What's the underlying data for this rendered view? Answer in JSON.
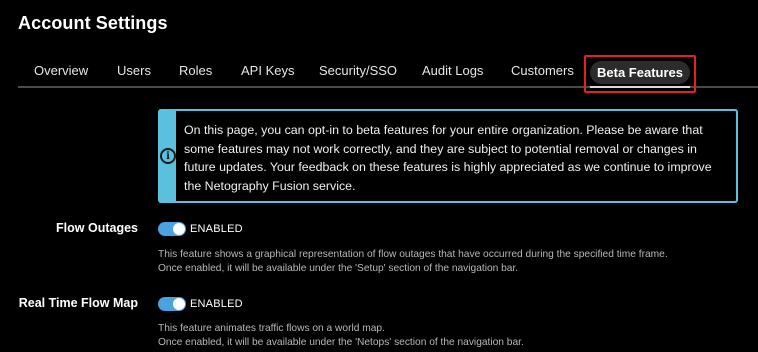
{
  "page": {
    "title": "Account Settings"
  },
  "tabs": [
    {
      "label": "Overview"
    },
    {
      "label": "Users"
    },
    {
      "label": "Roles"
    },
    {
      "label": "API Keys"
    },
    {
      "label": "Security/SSO"
    },
    {
      "label": "Audit Logs"
    },
    {
      "label": "Customers"
    },
    {
      "label": "Beta Features",
      "active": true
    }
  ],
  "info": {
    "icon": "info-icon",
    "text": "On this page, you can opt-in to beta features for your entire organization. Please be aware that some features may not work correctly, and they are subject to potential removal or changes in future updates. Your feedback on these features is highly appreciated as we continue to improve the Netography Fusion service."
  },
  "features": [
    {
      "label": "Flow Outages",
      "state": "ENABLED",
      "enabled": true,
      "desc_line1": "This feature shows a graphical representation of flow outages that have occurred during the specified time frame.",
      "desc_line2": "Once enabled, it will be available under the 'Setup' section of the navigation bar."
    },
    {
      "label": "Real Time Flow Map",
      "state": "ENABLED",
      "enabled": true,
      "desc_line1": "This feature animates traffic flows on a world map.",
      "desc_line2": "Once enabled, it will be available under the 'Netops' section of the navigation bar."
    }
  ],
  "colors": {
    "accent": "#4aa3df",
    "info_border": "#5bc0de",
    "highlight_box": "#e0241b",
    "background": "#000000"
  }
}
